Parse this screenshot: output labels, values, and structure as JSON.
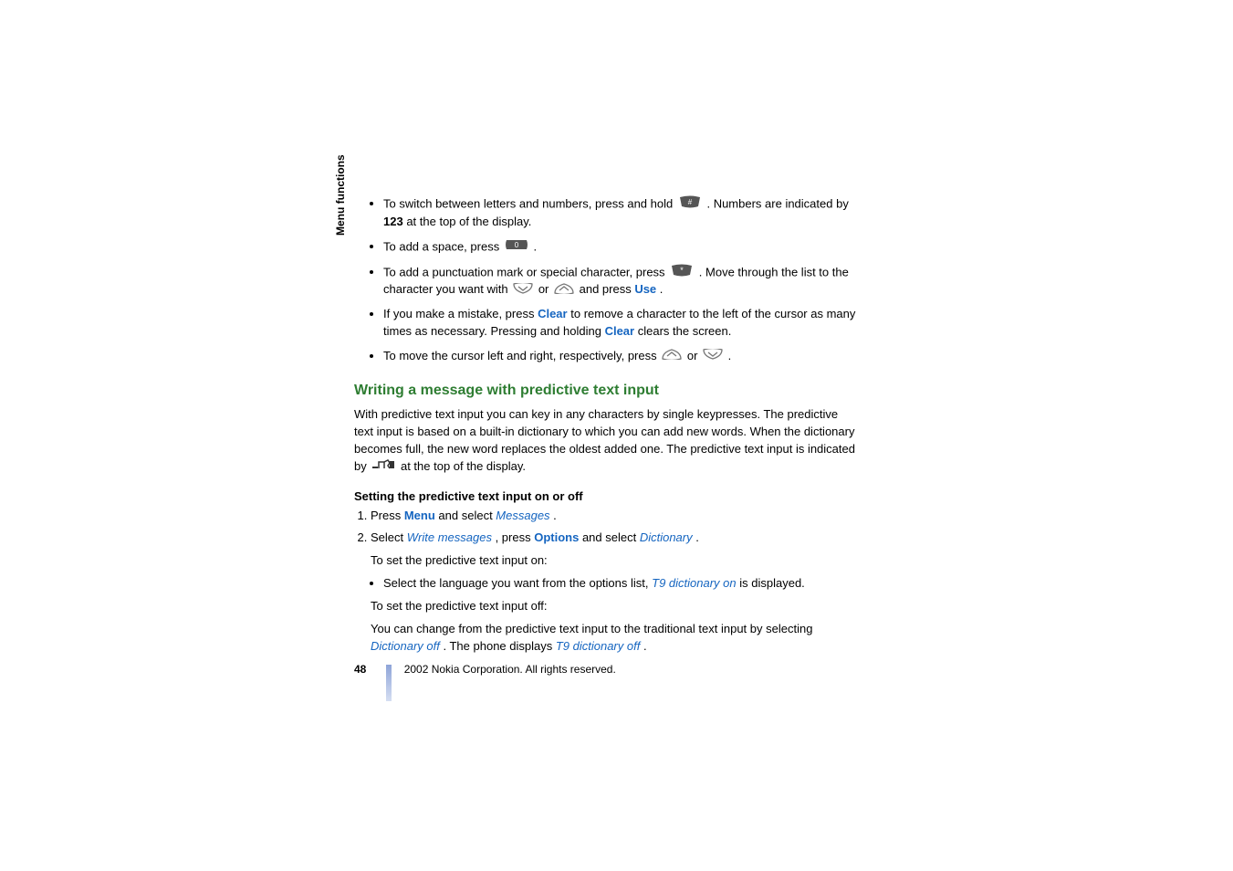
{
  "side": {
    "label": "Menu functions"
  },
  "bullets": {
    "b1_pre": "To switch between letters and numbers, press and hold ",
    "b1_mid": ". Numbers are indicated by ",
    "b1_num": "123",
    "b1_post": " at the top of the display.",
    "b2_pre": "To add a space, press ",
    "b2_post": ".",
    "b3_pre": "To add a punctuation mark or special character, press ",
    "b3_mid1": ". Move through the list to the character you want with ",
    "b3_mid2": " or ",
    "b3_mid3": " and press ",
    "b3_use": "Use",
    "b3_post": ".",
    "b4_pre": "If you make a mistake, press ",
    "b4_clear1": "Clear",
    "b4_mid": " to remove a character to the left of the cursor as many times as necessary. Pressing and holding ",
    "b4_clear2": "Clear",
    "b4_post": " clears the screen.",
    "b5_pre": "To move the cursor left and right, respectively, press ",
    "b5_mid": " or ",
    "b5_post": "."
  },
  "section": {
    "heading": "Writing a message with predictive text input",
    "para_pre": "With predictive text input you can key in any characters by single keypresses. The predictive text input is based on a built-in dictionary to which you can add new words. When the dictionary becomes full, the new word replaces the oldest added one. The predictive text input is indicated by ",
    "para_post": " at the top of the display.",
    "subheading": "Setting the predictive text input on or off",
    "step1_pre": "Press ",
    "step1_menu": "Menu",
    "step1_mid": " and select ",
    "step1_messages": "Messages",
    "step1_post": ".",
    "step2_pre": "Select ",
    "step2_wm": "Write messages",
    "step2_mid1": ", press ",
    "step2_options": "Options",
    "step2_mid2": " and select ",
    "step2_dict": "Dictionary",
    "step2_post": ".",
    "on_intro": "To set the predictive text input on:",
    "on_bullet_pre": "Select the language you want from the options list, ",
    "on_bullet_link": "T9 dictionary on",
    "on_bullet_post": " is displayed.",
    "off_intro": "To set the predictive text input off:",
    "off_para_pre": "You can change from the predictive text input to the traditional text input by selecting ",
    "off_para_link1": "Dictionary off",
    "off_para_mid": ". The phone displays ",
    "off_para_link2": "T9 dictionary off",
    "off_para_post": "."
  },
  "footer": {
    "page": "48",
    "copyright": " 2002 Nokia Corporation. All rights reserved."
  }
}
